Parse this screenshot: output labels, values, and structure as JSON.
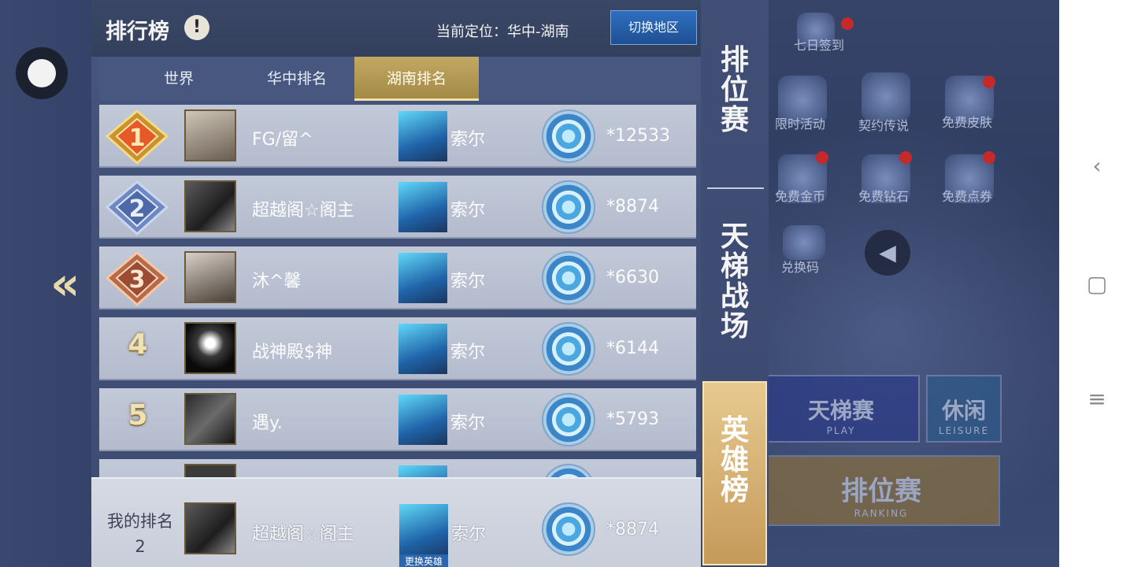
{
  "panel": {
    "title": "排行榜",
    "info_icon": "!",
    "location": "当前定位：华中-湖南",
    "switch_region": "切换地区"
  },
  "tabs": [
    {
      "label": "世界",
      "active": false
    },
    {
      "label": "华中排名",
      "active": false
    },
    {
      "label": "湖南排名",
      "active": true
    }
  ],
  "rows": [
    {
      "rank": "1",
      "name": "FG/留^",
      "hero": "索尔",
      "score": "*12533"
    },
    {
      "rank": "2",
      "name": "超越阁☆阁主",
      "hero": "索尔",
      "score": "*8874"
    },
    {
      "rank": "3",
      "name": "沐^馨",
      "hero": "索尔",
      "score": "*6630"
    },
    {
      "rank": "4",
      "name": "战神殿$神",
      "hero": "索尔",
      "score": "*6144"
    },
    {
      "rank": "5",
      "name": "遇y.",
      "hero": "索尔",
      "score": "*5793"
    }
  ],
  "my_rank": {
    "label": "我的排名",
    "rank": "2",
    "name": "超越阁☆阁主",
    "hero": "索尔",
    "change_hero": "更换英雄",
    "score": "*8874"
  },
  "side_tabs": [
    {
      "label": "排位赛",
      "active": false
    },
    {
      "label": "天梯战场",
      "active": false
    },
    {
      "label": "英雄榜",
      "active": true
    }
  ],
  "background": {
    "labels": [
      "七日签到",
      "限时活动",
      "契约传说",
      "免费皮肤",
      "免费金币",
      "免费钻石",
      "免费点券",
      "兑换码"
    ],
    "ladder_button": "天梯赛",
    "ladder_sub": "PLAY",
    "leisure_button": "休闲",
    "leisure_sub": "LEISURE",
    "ranking_button": "排位赛",
    "ranking_sub": "RANKING"
  },
  "colors": {
    "active_tab": "#c3a862",
    "row_bg": "#c2c9d8",
    "switch_button": "#2e6fc0"
  }
}
